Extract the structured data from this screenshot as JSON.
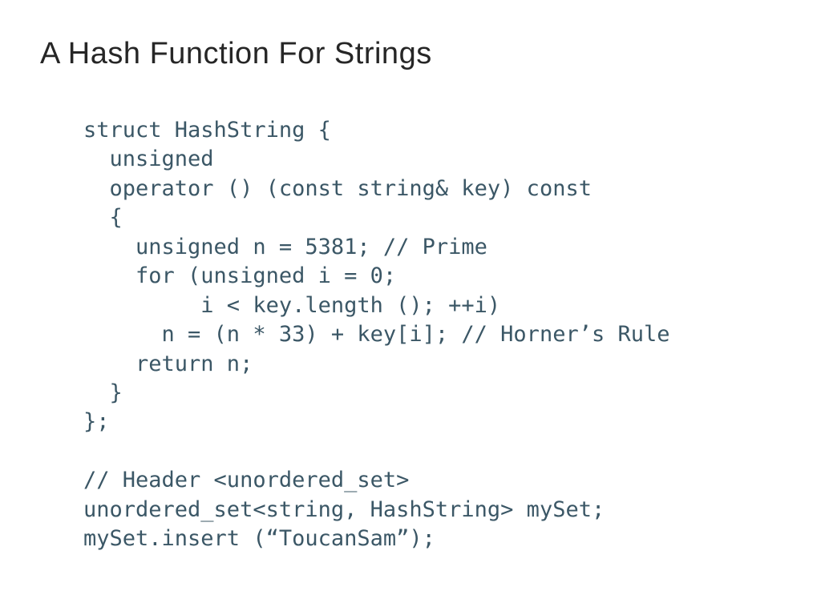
{
  "slide": {
    "title": "A Hash Function For Strings",
    "code": "struct HashString {\n  unsigned\n  operator () (const string& key) const\n  {\n    unsigned n = 5381; // Prime\n    for (unsigned i = 0;\n         i < key.length (); ++i)\n      n = (n * 33) + key[i]; // Horner’s Rule\n    return n;\n  }\n};\n\n// Header <unordered_set>\nunordered_set<string, HashString> mySet;\nmySet.insert (“ToucanSam”);"
  }
}
